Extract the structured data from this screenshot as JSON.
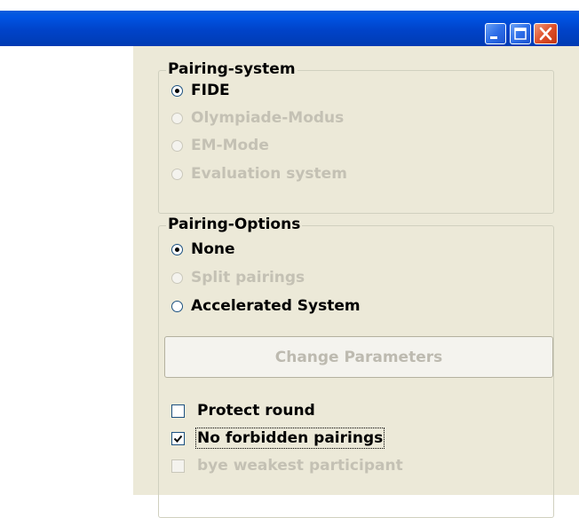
{
  "window": {
    "buttons": {
      "minimize_icon": "minimize-icon",
      "maximize_icon": "maximize-icon",
      "close_icon": "close-icon"
    }
  },
  "pairing_system": {
    "title": "Pairing-system",
    "options": [
      {
        "label": "FIDE",
        "selected": true,
        "enabled": true
      },
      {
        "label": "Olympiade-Modus",
        "selected": false,
        "enabled": false
      },
      {
        "label": "EM-Mode",
        "selected": false,
        "enabled": false
      },
      {
        "label": "Evaluation system",
        "selected": false,
        "enabled": false
      }
    ]
  },
  "pairing_options": {
    "title": "Pairing-Options",
    "options": [
      {
        "label": "None",
        "selected": true,
        "enabled": true
      },
      {
        "label": "Split pairings",
        "selected": false,
        "enabled": false
      },
      {
        "label": "Accelerated System",
        "selected": false,
        "enabled": true
      }
    ],
    "change_parameters_label": "Change Parameters",
    "checkboxes": [
      {
        "label": "Protect round",
        "checked": false,
        "enabled": true
      },
      {
        "label": "No forbidden pairings",
        "checked": true,
        "enabled": true
      },
      {
        "label": "bye weakest participant",
        "checked": false,
        "enabled": false
      }
    ]
  },
  "colors": {
    "titlebar": "#0054e3",
    "panel": "#ece9d8",
    "disabled_text": "#c4c1b4"
  }
}
